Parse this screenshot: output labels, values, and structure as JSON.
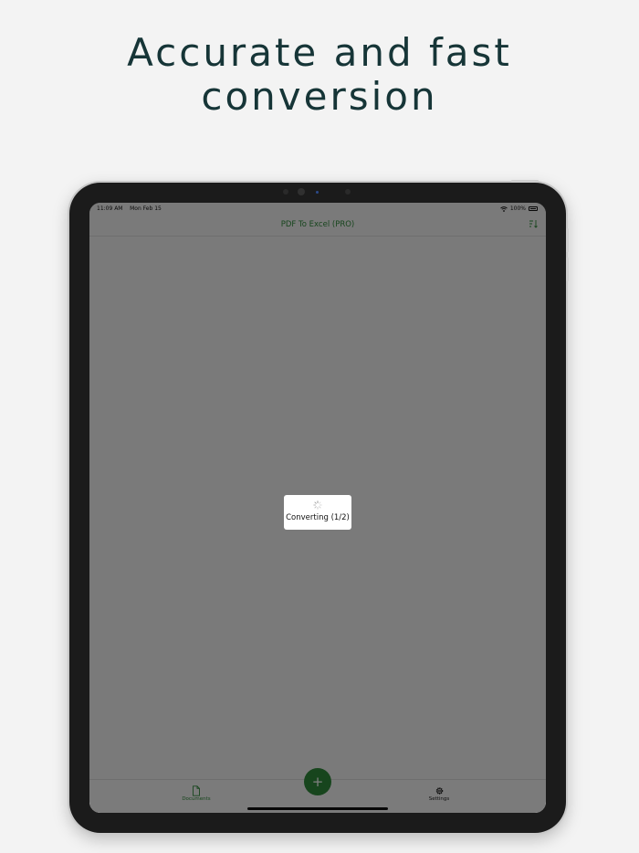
{
  "headline": {
    "line1": "Accurate and fast",
    "line2": "conversion"
  },
  "statusbar": {
    "time": "11:09 AM",
    "date": "Mon Feb 15",
    "battery": "100%",
    "wifi_icon": "wifi-icon",
    "battery_icon": "battery-icon"
  },
  "navbar": {
    "title": "PDF To Excel (PRO)",
    "sort_icon": "sort-icon"
  },
  "tabbar": {
    "documents_label": "Documents",
    "documents_icon": "document-icon",
    "add_label": "+",
    "settings_label": "Settings",
    "settings_icon": "gear-icon"
  },
  "hud": {
    "label": "Converting (1/2)",
    "spinner_icon": "spinner-icon"
  },
  "colors": {
    "accent": "#2f8a3a",
    "headline": "#163537",
    "overlay": "rgba(0,0,0,0.5)"
  }
}
